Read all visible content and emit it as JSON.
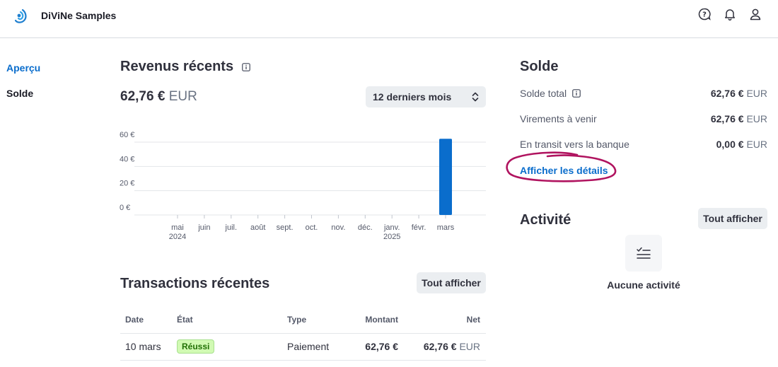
{
  "header": {
    "brand_name": "DiViNe Samples",
    "icons": [
      "help-icon",
      "bell-icon",
      "user-icon"
    ]
  },
  "sidebar": {
    "items": [
      {
        "label": "Aperçu",
        "active": true
      },
      {
        "label": "Solde",
        "active": false
      }
    ]
  },
  "revenue": {
    "title": "Revenus récents",
    "amount": "62,76 €",
    "currency": "EUR",
    "period_select": "12 derniers mois"
  },
  "chart_data": {
    "type": "bar",
    "categories": [
      "mai 2024",
      "juin",
      "juil.",
      "août",
      "sept.",
      "oct.",
      "nov.",
      "déc.",
      "janv. 2025",
      "févr.",
      "mars"
    ],
    "x_tick_labels": [
      {
        "line1": "mai",
        "line2": "2024"
      },
      {
        "line1": "juin",
        "line2": ""
      },
      {
        "line1": "juil.",
        "line2": ""
      },
      {
        "line1": "août",
        "line2": ""
      },
      {
        "line1": "sept.",
        "line2": ""
      },
      {
        "line1": "oct.",
        "line2": ""
      },
      {
        "line1": "nov.",
        "line2": ""
      },
      {
        "line1": "déc.",
        "line2": ""
      },
      {
        "line1": "janv.",
        "line2": "2025"
      },
      {
        "line1": "févr.",
        "line2": ""
      },
      {
        "line1": "mars",
        "line2": ""
      }
    ],
    "values": [
      0,
      0,
      0,
      0,
      0,
      0,
      0,
      0,
      0,
      0,
      62.76
    ],
    "y_ticks": [
      "60 €",
      "40 €",
      "20 €",
      "0 €"
    ],
    "y_tick_values": [
      60,
      40,
      20,
      0
    ],
    "ylim": [
      0,
      60
    ],
    "grid": true,
    "bar_color": "#0a6dcc"
  },
  "transactions": {
    "title": "Transactions récentes",
    "view_all": "Tout afficher",
    "columns": [
      "Date",
      "État",
      "Type",
      "Montant",
      "Net"
    ],
    "rows": [
      {
        "date": "10 mars",
        "status": "Réussi",
        "type": "Paiement",
        "amount": "62,76 €",
        "net": "62,76 €",
        "net_currency": "EUR"
      }
    ]
  },
  "balance": {
    "title": "Solde",
    "rows": [
      {
        "label": "Solde total",
        "value": "62,76 €",
        "currency": "EUR"
      },
      {
        "label": "Virements à venir",
        "value": "62,76 €",
        "currency": "EUR"
      },
      {
        "label": "En transit vers la banque",
        "value": "0,00 €",
        "currency": "EUR"
      }
    ],
    "details_link": "Afficher les détails",
    "annotation_color": "#b0135f"
  },
  "activity": {
    "title": "Activité",
    "view_all": "Tout afficher",
    "empty_text": "Aucune activité"
  }
}
